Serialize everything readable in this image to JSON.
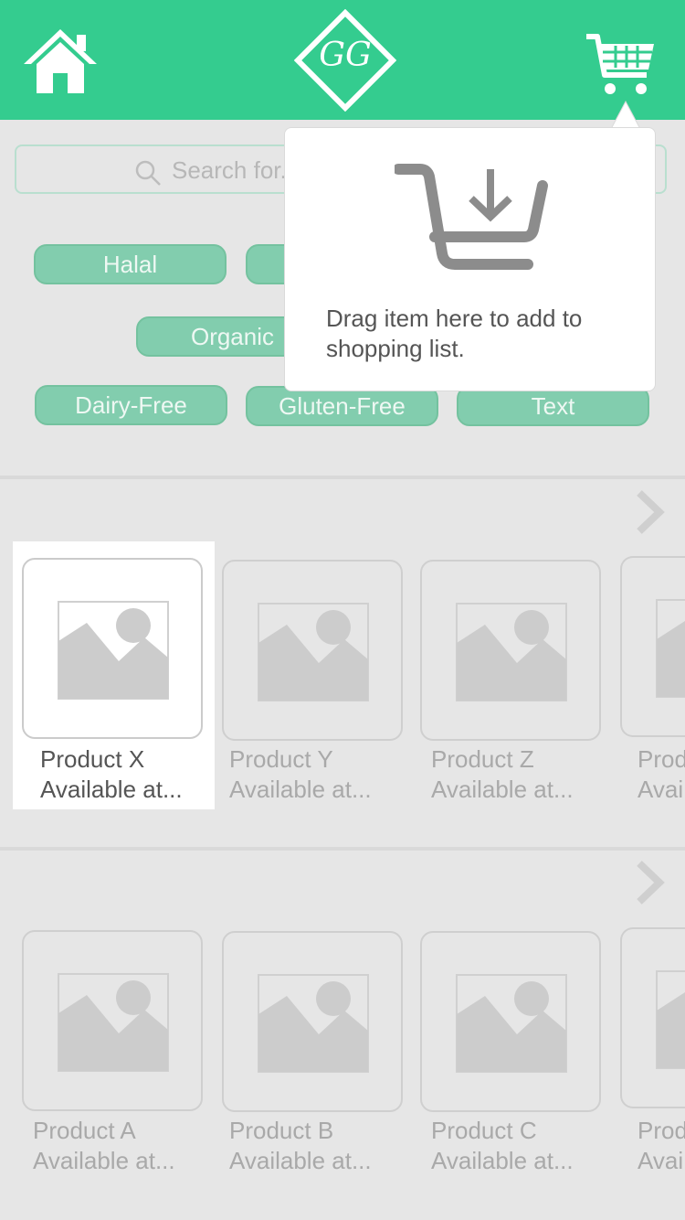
{
  "header": {
    "home_icon": "home-icon",
    "logo_text": "GG",
    "cart_icon": "shopping-cart-icon",
    "color": "#34cc8f"
  },
  "search": {
    "placeholder": "Search for..."
  },
  "filters": {
    "tags": [
      "Halal",
      "Organic",
      "Dairy-Free",
      "Gluten-Free",
      "Text"
    ]
  },
  "tooltip": {
    "icon": "drop-to-cart-icon",
    "message": "Drag item here to add to shopping list."
  },
  "row1": {
    "products": [
      {
        "name": "Product X",
        "availability": "Available at..."
      },
      {
        "name": "Product Y",
        "availability": "Available at..."
      },
      {
        "name": "Product Z",
        "availability": "Available at..."
      },
      {
        "name": "Prod",
        "availability": "Avai"
      }
    ]
  },
  "row2": {
    "products": [
      {
        "name": "Product A",
        "availability": "Available at..."
      },
      {
        "name": "Product B",
        "availability": "Available at..."
      },
      {
        "name": "Product C",
        "availability": "Available at..."
      },
      {
        "name": "Prod",
        "availability": "Avai"
      }
    ]
  }
}
